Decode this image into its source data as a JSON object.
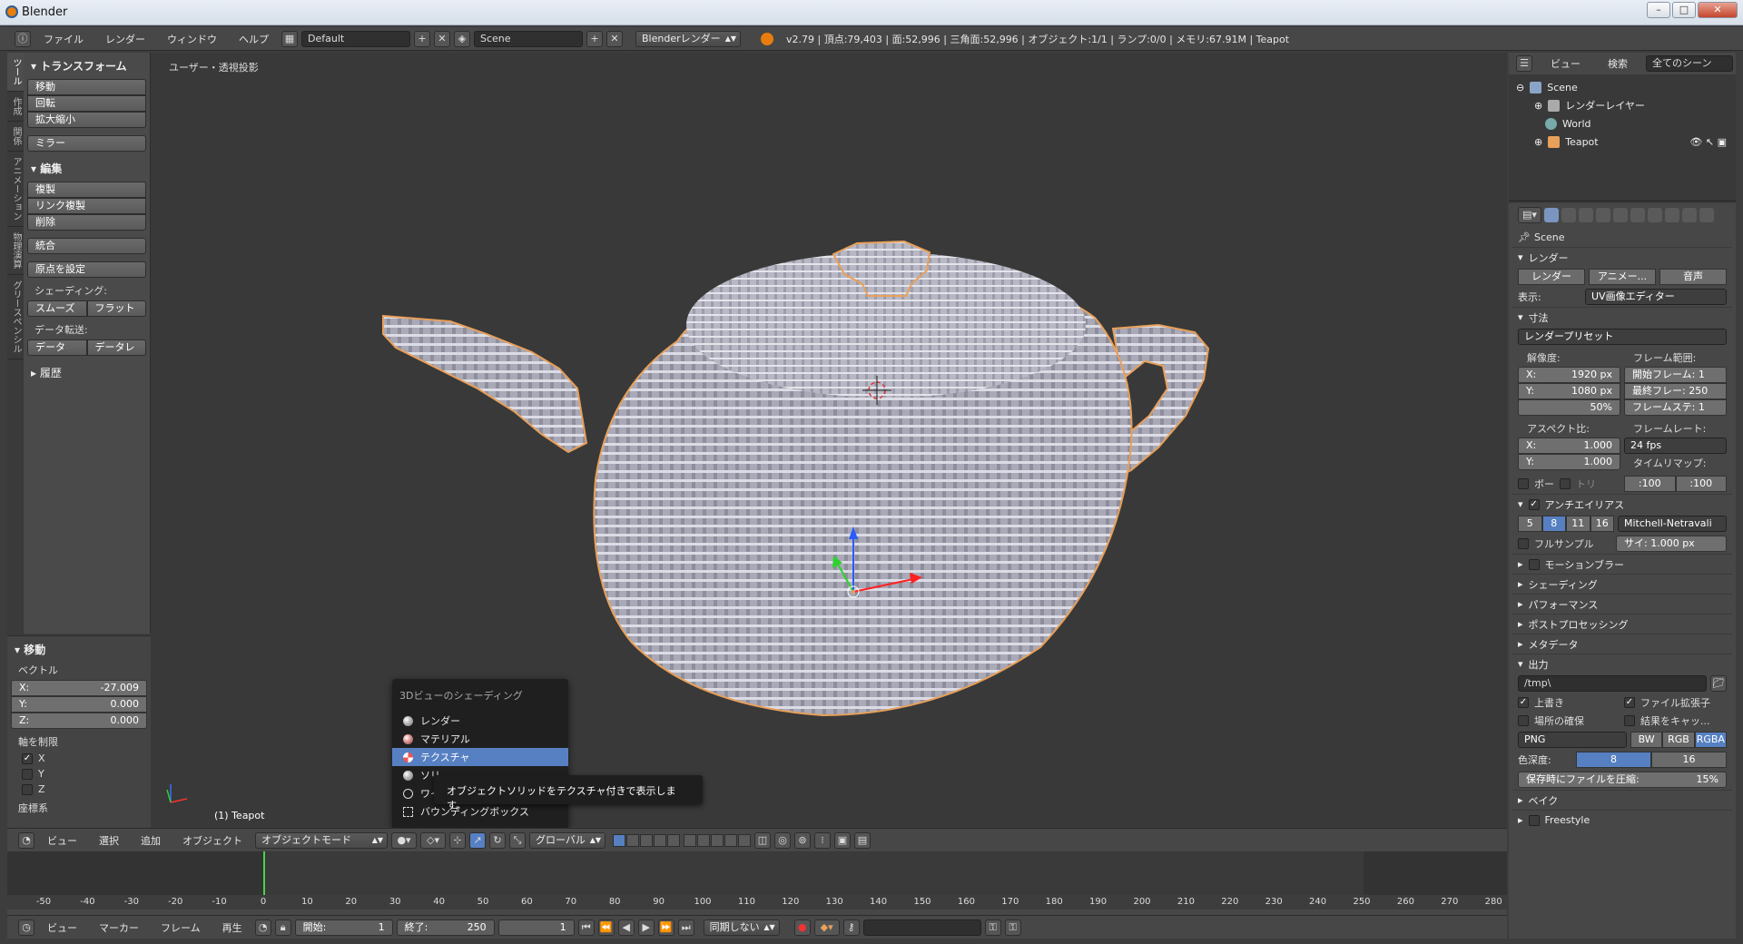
{
  "window": {
    "title": "Blender"
  },
  "info_header": {
    "menus": [
      "ファイル",
      "レンダー",
      "ウィンドウ",
      "ヘルプ"
    ],
    "screen_layout": "Default",
    "scene": "Scene",
    "render_engine": "Blenderレンダー",
    "stats": "v2.79 | 頂点:79,403 | 面:52,996 | 三角面:52,996 | オブジェクト:1/1 | ランプ:0/0 | メモリ:67.91M | Teapot"
  },
  "vertical_tabs": [
    "ツール",
    "作成",
    "関係",
    "アニメーション",
    "物理演算",
    "グリースペンシル"
  ],
  "tool_shelf": {
    "transform_title": "トランスフォーム",
    "transform_buttons": [
      "移動",
      "回転",
      "拡大縮小"
    ],
    "mirror": "ミラー",
    "edit_title": "編集",
    "edit_buttons": [
      "複製",
      "リンク複製",
      "削除"
    ],
    "join": "統合",
    "set_origin": "原点を設定",
    "shading_label": "シェーディング:",
    "smooth": "スムーズ",
    "flat": "フラット",
    "data_transfer_label": "データ転送:",
    "data": "データ",
    "data_layout": "データレ",
    "history_title": "履歴"
  },
  "operator_panel": {
    "title": "移動",
    "vector_label": "ベクトル",
    "x_label": "X:",
    "x_value": "-27.009",
    "y_label": "Y:",
    "y_value": "0.000",
    "z_label": "Z:",
    "z_value": "0.000",
    "constraint_label": "軸を制限",
    "axes": [
      "X",
      "Y",
      "Z"
    ],
    "orientation_label": "座標系"
  },
  "viewport": {
    "view_label": "ユーザー・透視投影",
    "object_label": "(1) Teapot"
  },
  "shading_menu": {
    "title": "3Dビューのシェーディング",
    "items": [
      "レンダー",
      "マテリアル",
      "テクスチャ",
      "ソリ",
      "ワイ",
      "バウンディングボックス"
    ],
    "tooltip": "オブジェクトソリッドをテクスチャ付きで表示します。"
  },
  "view3d_header": {
    "menus": [
      "ビュー",
      "選択",
      "追加",
      "オブジェクト"
    ],
    "mode": "オブジェクトモード",
    "orientation": "グローバル"
  },
  "timeline": {
    "ticks": [
      "-50",
      "-40",
      "-30",
      "-20",
      "-10",
      "0",
      "10",
      "20",
      "30",
      "40",
      "50",
      "60",
      "70",
      "80",
      "90",
      "100",
      "110",
      "120",
      "130",
      "140",
      "150",
      "160",
      "170",
      "180",
      "190",
      "200",
      "210",
      "220",
      "230",
      "240",
      "250",
      "260",
      "270",
      "280"
    ],
    "menus": [
      "ビュー",
      "マーカー",
      "フレーム",
      "再生"
    ],
    "start_label": "開始:",
    "start_value": "1",
    "end_label": "終了:",
    "end_value": "250",
    "current_value": "1",
    "sync": "同期しない"
  },
  "outliner": {
    "menus": [
      "ビュー",
      "検索"
    ],
    "filter": "全てのシーン",
    "items": [
      "Scene",
      "レンダーレイヤー",
      "World",
      "Teapot"
    ]
  },
  "properties": {
    "scene_label": "Scene",
    "render_section": "レンダー",
    "render_btn": "レンダー",
    "anim_btn": "アニメー...",
    "audio_btn": "音声",
    "display_label": "表示:",
    "display_value": "UV画像エディター",
    "dimensions_section": "寸法",
    "render_preset": "レンダープリセット",
    "resolution_label": "解像度:",
    "res_x": "X:",
    "res_x_val": "1920 px",
    "res_y": "Y:",
    "res_y_val": "1080 px",
    "res_pct": "50%",
    "frame_range_label": "フレーム範囲:",
    "start_frame": "開始フレーム: 1",
    "end_frame": "最終フレー: 250",
    "frame_step": "フレームステ: 1",
    "aspect_label": "アスペクト比:",
    "aspect_x": "X:",
    "aspect_x_val": "1.000",
    "aspect_y": "Y:",
    "aspect_y_val": "1.000",
    "frame_rate_label": "フレームレート:",
    "frame_rate": "24 fps",
    "time_remap_label": "タイムリマップ:",
    "time_old": ":100",
    "time_new": ":100",
    "border": "ボー",
    "crop": "トリ",
    "aa_section": "アンチエイリアス",
    "aa_samples": [
      "5",
      "8",
      "11",
      "16"
    ],
    "aa_filter": "Mitchell-Netravali",
    "full_sample": "フルサンプル",
    "size": "サイ: 1.000 px",
    "motion_blur": "モーションブラー",
    "shading": "シェーディング",
    "performance": "パフォーマンス",
    "post_processing": "ポストプロセッシング",
    "metadata": "メタデータ",
    "output_section": "出力",
    "output_path": "/tmp\\",
    "overwrite": "上書き",
    "file_ext": "ファイル拡張子",
    "placeholders": "場所の確保",
    "cache_result": "結果をキャッ...",
    "format": "PNG",
    "color_modes": [
      "BW",
      "RGB",
      "RGBA"
    ],
    "color_depth_label": "色深度:",
    "depths": [
      "8",
      "16"
    ],
    "compression": "保存時にファイルを圧縮:",
    "compression_val": "15%",
    "bake": "ベイク",
    "freestyle": "Freestyle"
  }
}
